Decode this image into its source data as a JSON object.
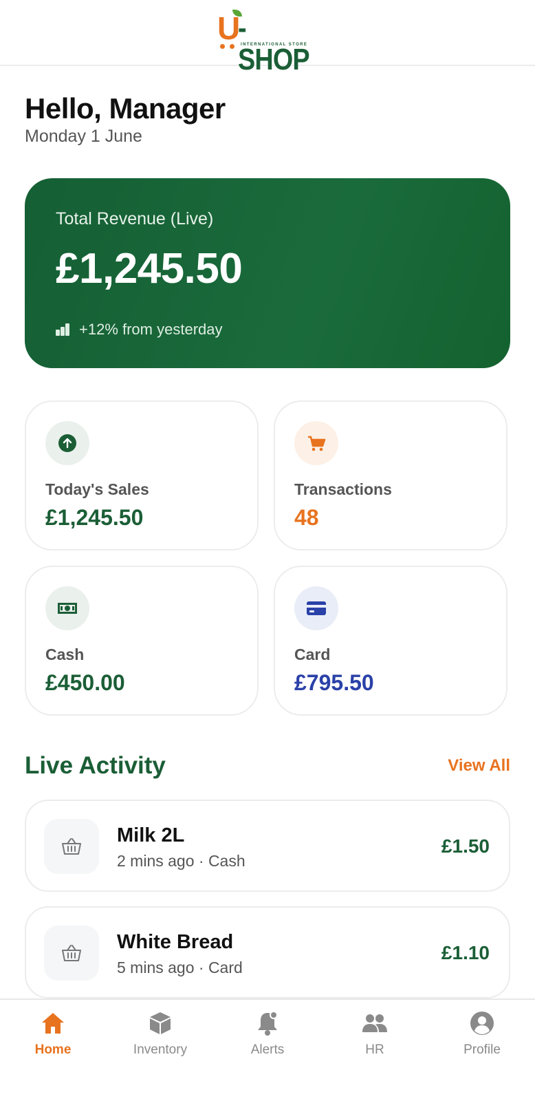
{
  "header": {
    "logo_letter": "U",
    "logo_text": "-SHOP",
    "logo_subtitle": "INTERNATIONAL STORE"
  },
  "greeting": {
    "title": "Hello, Manager",
    "date": "Monday 1 June"
  },
  "revenue": {
    "label": "Total Revenue (Live)",
    "value": "£1,245.50",
    "trend": "+12% from yesterday"
  },
  "stats": [
    {
      "label": "Today's Sales",
      "value": "£1,245.50",
      "icon": "arrow-up-circle-icon",
      "color": "#1b5e36",
      "bg": "#eaf0ec"
    },
    {
      "label": "Transactions",
      "value": "48",
      "icon": "cart-icon",
      "color": "#e8731f",
      "bg": "#fdf0e6"
    },
    {
      "label": "Cash",
      "value": "£450.00",
      "icon": "banknote-icon",
      "color": "#1b5e36",
      "bg": "#eaf0ec"
    },
    {
      "label": "Card",
      "value": "£795.50",
      "icon": "credit-card-icon",
      "color": "#2a41a8",
      "bg": "#e9edf7"
    }
  ],
  "live_activity": {
    "title": "Live Activity",
    "view_all": "View All",
    "items": [
      {
        "name": "Milk 2L",
        "meta": "2 mins ago · Cash",
        "amount": "£1.50",
        "icon": "basket-icon"
      },
      {
        "name": "White Bread",
        "meta": "5 mins ago · Card",
        "amount": "£1.10",
        "icon": "basket-icon"
      }
    ]
  },
  "nav": [
    {
      "label": "Home",
      "icon": "home-icon",
      "active": true
    },
    {
      "label": "Inventory",
      "icon": "box-icon",
      "active": false
    },
    {
      "label": "Alerts",
      "icon": "bell-icon",
      "active": false
    },
    {
      "label": "HR",
      "icon": "people-icon",
      "active": false
    },
    {
      "label": "Profile",
      "icon": "user-circle-icon",
      "active": false
    }
  ],
  "colors": {
    "brand_green": "#1b5e36",
    "brand_orange": "#e8731f",
    "card_blue": "#2a41a8",
    "nav_inactive": "#8a8a8a"
  }
}
